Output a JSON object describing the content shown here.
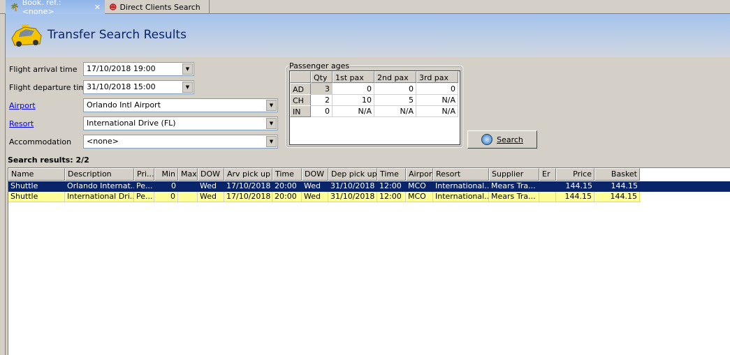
{
  "tabs": [
    {
      "label": "Book. ref.: <none>",
      "icon": "palm-tree-icon",
      "active": true
    },
    {
      "label": "Direct Clients Search",
      "icon": "person-icon",
      "active": false
    }
  ],
  "header": {
    "title": "Transfer Search Results",
    "icon": "taxi-icon"
  },
  "form": {
    "arrival_label": "Flight arrival time",
    "arrival_value": "17/10/2018 19:00",
    "departure_label": "Flight departure time",
    "departure_value": "31/10/2018 15:00",
    "airport_label": "Airport",
    "airport_value": "Orlando Intl Airport",
    "resort_label": "Resort",
    "resort_value": "International Drive (FL)",
    "accommodation_label": "Accommodation",
    "accommodation_value": "<none>"
  },
  "passengers": {
    "title": "Passenger ages",
    "columns": [
      "",
      "Qty",
      "1st pax",
      "2nd pax",
      "3rd pax"
    ],
    "rows": [
      [
        "AD",
        "3",
        "0",
        "0",
        "0"
      ],
      [
        "CH",
        "2",
        "10",
        "5",
        "N/A"
      ],
      [
        "IN",
        "0",
        "N/A",
        "N/A",
        "N/A"
      ]
    ]
  },
  "search_button": "Search",
  "results": {
    "label": "Search results: 2/2",
    "columns": [
      "Name",
      "Description",
      "Pri...",
      "Min",
      "Max",
      "DOW",
      "Arv pick up",
      "Time",
      "DOW",
      "Dep pick up",
      "Time",
      "Airport",
      "Resort",
      "Supplier",
      "Er",
      "Price",
      "Basket"
    ],
    "rows": [
      [
        "Shuttle",
        "Orlando Internat...",
        "Pe...",
        "0",
        "",
        "Wed",
        "17/10/2018",
        "20:00",
        "Wed",
        "31/10/2018",
        "12:00",
        "MCO",
        "International...",
        "Mears Tra...",
        "",
        "144.15",
        "144.15"
      ],
      [
        "Shuttle",
        "International Dri...",
        "Pe...",
        "0",
        "",
        "Wed",
        "17/10/2018",
        "20:00",
        "Wed",
        "31/10/2018",
        "12:00",
        "MCO",
        "International...",
        "Mears Tra...",
        "",
        "144.15",
        "144.15"
      ]
    ]
  }
}
